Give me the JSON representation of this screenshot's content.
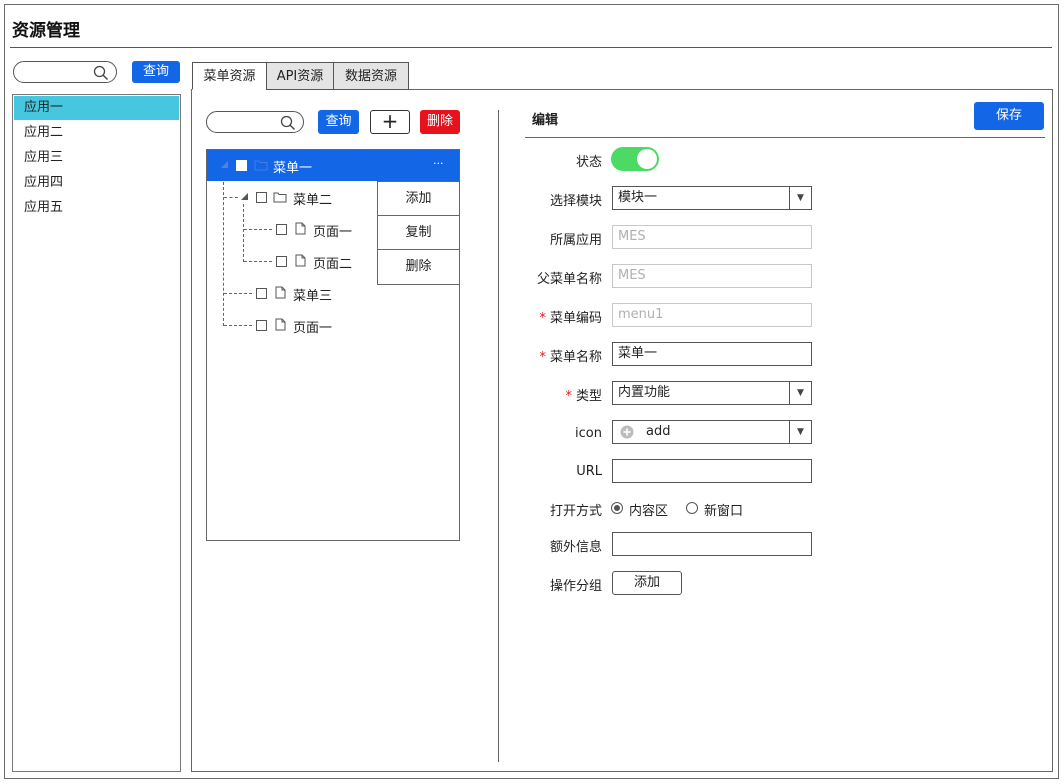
{
  "page": {
    "title": "资源管理"
  },
  "left": {
    "search": {
      "placeholder": "",
      "button_label": "查询"
    },
    "apps": [
      {
        "label": "应用一",
        "selected": true
      },
      {
        "label": "应用二",
        "selected": false
      },
      {
        "label": "应用三",
        "selected": false
      },
      {
        "label": "应用四",
        "selected": false
      },
      {
        "label": "应用五",
        "selected": false
      }
    ]
  },
  "tabs": [
    {
      "label": "菜单资源",
      "active": true
    },
    {
      "label": "API资源",
      "active": false
    },
    {
      "label": "数据资源",
      "active": false
    }
  ],
  "tree": {
    "search": {
      "placeholder": "",
      "button_label": "查询"
    },
    "add_label": "+",
    "delete_label": "删除",
    "nodes": [
      {
        "label": "菜单一",
        "type": "folder",
        "selected": true,
        "more": "···"
      },
      {
        "label": "菜单二",
        "type": "folder"
      },
      {
        "label": "页面一",
        "type": "page"
      },
      {
        "label": "页面二",
        "type": "page"
      },
      {
        "label": "菜单三",
        "type": "page"
      },
      {
        "label": "页面一",
        "type": "page"
      }
    ],
    "context_menu": [
      "添加",
      "复制",
      "删除"
    ]
  },
  "edit": {
    "title": "编辑",
    "save_label": "保存",
    "fields": {
      "status": {
        "label": "状态",
        "on": true
      },
      "module": {
        "label": "选择模块",
        "value": "模块一"
      },
      "app": {
        "label": "所属应用",
        "value": "MES"
      },
      "parent": {
        "label": "父菜单名称",
        "value": "MES"
      },
      "code": {
        "label": "菜单编码",
        "value": "menu1",
        "required": "*"
      },
      "name": {
        "label": "菜单名称",
        "value": "菜单一",
        "required": "*"
      },
      "type": {
        "label": "类型",
        "value": "内置功能",
        "required": "*"
      },
      "icon": {
        "label": "icon",
        "value": "add"
      },
      "url": {
        "label": "URL",
        "value": ""
      },
      "open": {
        "label": "打开方式",
        "options": [
          "内容区",
          "新窗口"
        ],
        "selected": "内容区"
      },
      "extra": {
        "label": "额外信息",
        "value": ""
      },
      "group": {
        "label": "操作分组",
        "button_label": "添加"
      }
    }
  },
  "colors": {
    "primary": "#1366e6",
    "danger": "#e8121c",
    "selected_app": "#46c6df",
    "toggle_on": "#4cd964"
  }
}
